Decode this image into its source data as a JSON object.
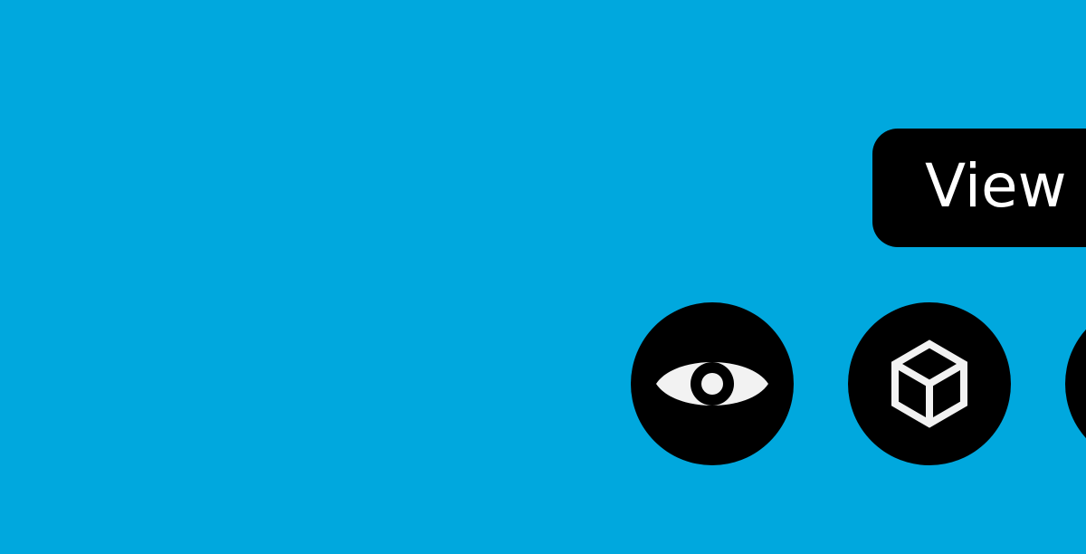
{
  "tooltip": {
    "label": "View"
  },
  "toolbar": {
    "buttons": [
      {
        "icon": "eye-icon"
      },
      {
        "icon": "cube-icon"
      },
      {
        "icon": "unknown-icon"
      }
    ]
  },
  "colors": {
    "background": "#00a8de",
    "button": "#000000",
    "icon": "#f2f2f2",
    "tooltip_text": "#ffffff"
  }
}
